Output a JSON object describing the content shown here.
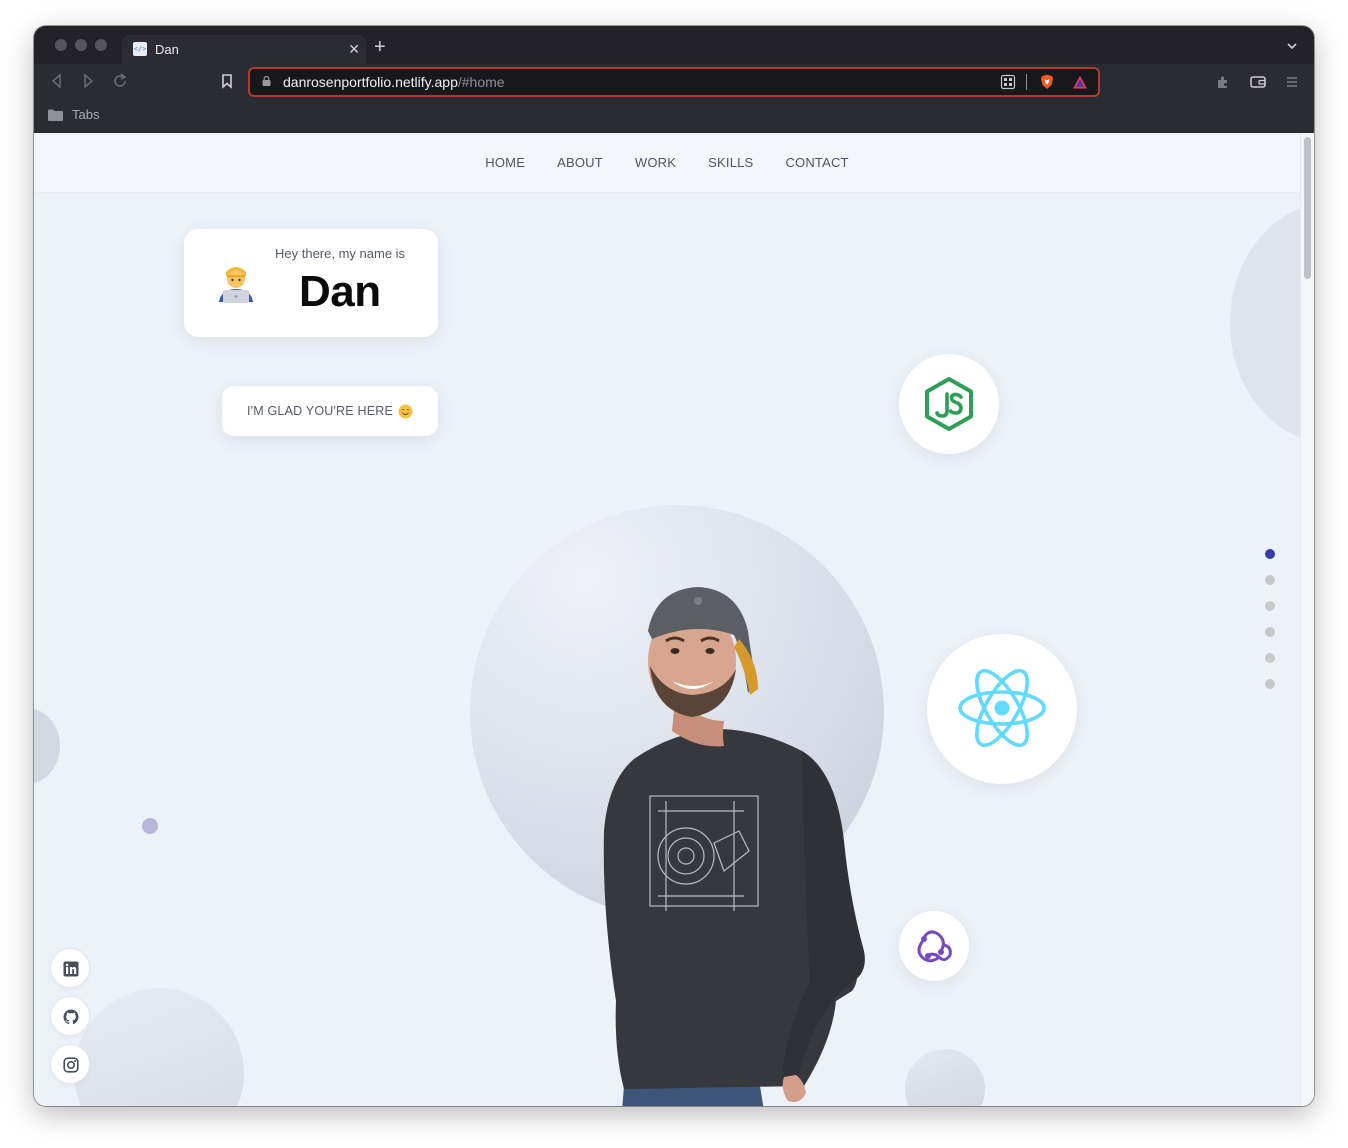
{
  "browser": {
    "tab_title": "Dan",
    "tab_favicon": "</>",
    "close_glyph": "✕",
    "new_tab_glyph": "+",
    "url_host": "danrosenportfolio.netlify.app",
    "url_path": "/#home",
    "bookmark_folder": "Tabs",
    "accent_color": "#b23b2b"
  },
  "nav": {
    "items": [
      "HOME",
      "ABOUT",
      "WORK",
      "SKILLS",
      "CONTACT"
    ]
  },
  "hero": {
    "greeting": "Hey there, my name is",
    "name": "Dan",
    "glad_text": "I'M GLAD YOU'RE HERE",
    "tech_icons": [
      "nodejs-icon",
      "react-icon",
      "redux-icon"
    ]
  },
  "section_dots": {
    "count": 6,
    "active_index": 0,
    "active_color": "#313bac"
  },
  "social": [
    "linkedin-icon",
    "github-icon",
    "instagram-icon"
  ]
}
